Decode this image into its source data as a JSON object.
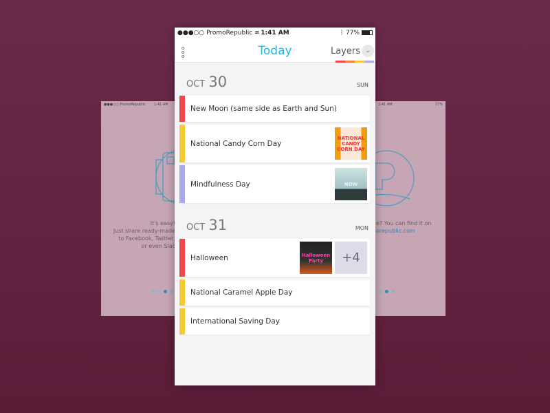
{
  "colors": {
    "accent": "#20b7e8",
    "red": "#f0474f",
    "yellow": "#f6cc34",
    "lavender": "#a9a8e8",
    "orange": "#f47a4a"
  },
  "status": {
    "carrier": "●●●○○ PromoRepublic",
    "time": "1:41 AM",
    "battery": "77%",
    "battery_level": 0.77
  },
  "header": {
    "title": "Today",
    "layers": "Layers"
  },
  "left_slide": {
    "carrier": "●●●○○ PromoRepublic",
    "time": "1:41 AM",
    "text": [
      "It's easy!",
      "Just share ready-made",
      "to Facebook, Twitter,",
      "or even Slac"
    ]
  },
  "right_slide": {
    "time": "1:41 AM",
    "battery": "77%",
    "text": "e? You can find it on",
    "link": "orepublic.com"
  },
  "days": [
    {
      "month": "OCT",
      "day": "30",
      "weekday": "SUN",
      "events": [
        {
          "label": "New Moon (same side as Earth and Sun)",
          "color": "red",
          "thumbs": []
        },
        {
          "label": "National Candy Corn Day",
          "color": "yellow",
          "thumbs": [
            {
              "text": "NATIONAL CANDY CORN DAY",
              "style": "candy"
            }
          ]
        },
        {
          "label": "Mindfulness Day",
          "color": "lavender",
          "thumbs": [
            {
              "text": "NOW",
              "style": "mind"
            }
          ]
        }
      ]
    },
    {
      "month": "OCT",
      "day": "31",
      "weekday": "MON",
      "events": [
        {
          "label": "Halloween",
          "color": "red",
          "thumbs": [
            {
              "text": "Halloween Party",
              "style": "party"
            },
            {
              "text": "+4",
              "style": "more"
            }
          ]
        },
        {
          "label": "National Caramel Apple Day",
          "color": "yellow",
          "thumbs": []
        },
        {
          "label": "International Saving Day",
          "color": "yellow",
          "thumbs": []
        }
      ]
    }
  ]
}
